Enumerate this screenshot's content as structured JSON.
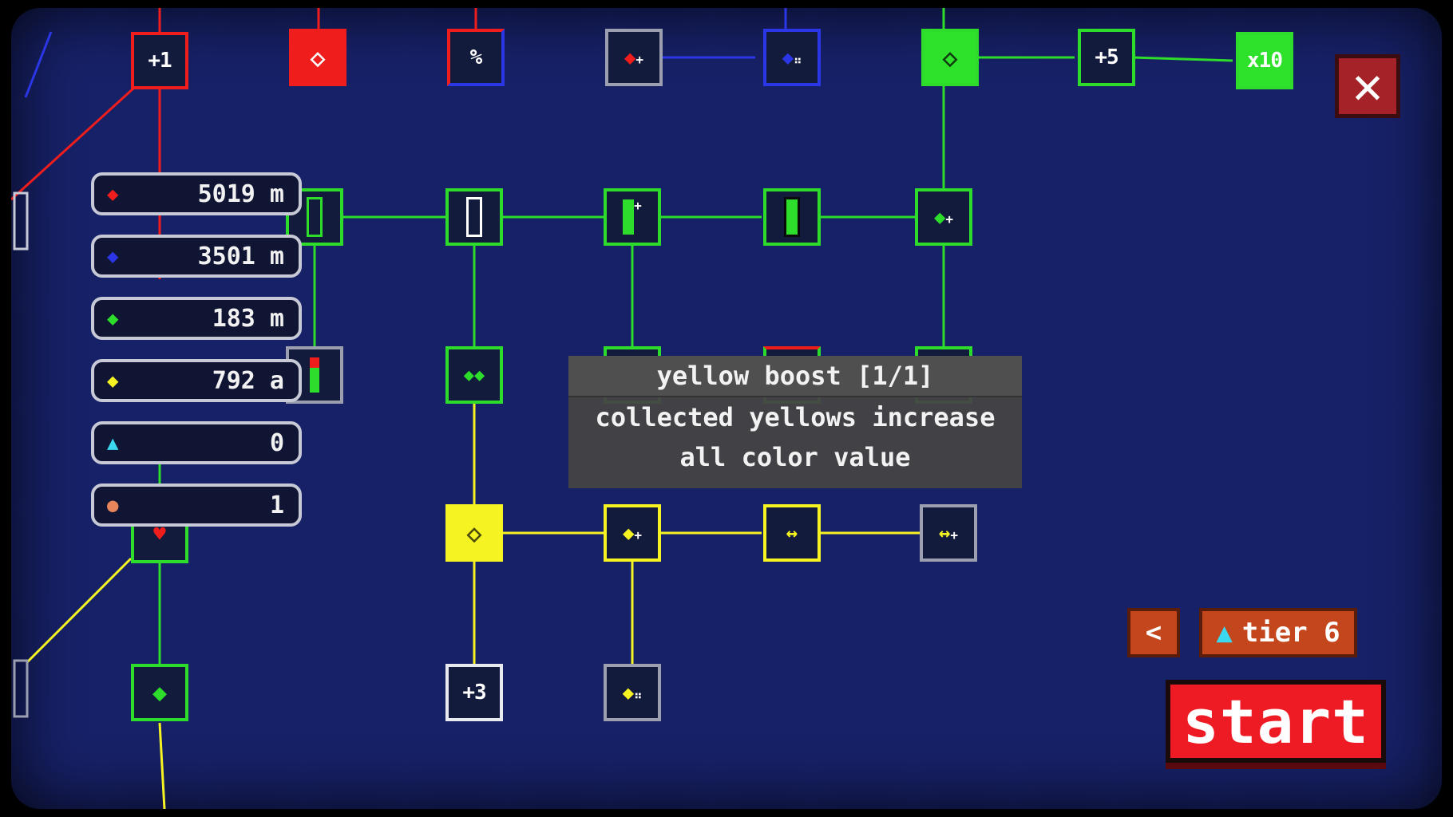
{
  "resources": [
    {
      "icon": "red-gem-icon",
      "color": "#f01d1d",
      "value": "5019 m"
    },
    {
      "icon": "blue-gem-icon",
      "color": "#2b36e6",
      "value": "3501 m"
    },
    {
      "icon": "green-gem-icon",
      "color": "#2edc2b",
      "value": "183 m"
    },
    {
      "icon": "yellow-gem-icon",
      "color": "#f5f322",
      "value": "792 a"
    },
    {
      "icon": "cyan-gem-icon",
      "color": "#3bd9f0",
      "value": "0"
    },
    {
      "icon": "orange-pouch-icon",
      "color": "#e8855a",
      "value": "1"
    }
  ],
  "upgrades": {
    "plus1": "+1",
    "plus5": "+5",
    "x10": "x10",
    "plus3": "+3",
    "percent": "%"
  },
  "tooltip": {
    "title": "yellow boost [1/1]",
    "line1": "collected yellows increase",
    "line2": "all color value"
  },
  "controls": {
    "close": "✕",
    "prev": "<",
    "tier": "tier 6",
    "start": "start"
  },
  "colors": {
    "background": "#172167",
    "green": "#2edc2b",
    "yellow": "#f5f322",
    "red": "#f01d1d",
    "blue": "#2b36e6",
    "start": "#ee1b24",
    "tier": "#c4461d"
  }
}
